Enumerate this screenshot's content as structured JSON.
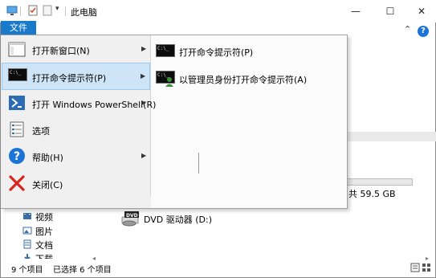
{
  "window": {
    "title": "此电脑",
    "minimize_glyph": "—",
    "maximize_glyph": "☐",
    "close_glyph": "✕",
    "help_glyph": "?",
    "ribbon_collapse_glyph": "⌃"
  },
  "file_menu": {
    "tab_label": "文件",
    "items": [
      {
        "label": "打开新窗口(N)",
        "icon": "window-icon",
        "has_submenu": true
      },
      {
        "label": "打开命令提示符(P)",
        "icon": "cmd-icon",
        "has_submenu": true,
        "highlighted": true
      },
      {
        "label": "打开 Windows PowerShell(R)",
        "icon": "powershell-icon",
        "has_submenu": true
      },
      {
        "label": "选项",
        "icon": "options-icon",
        "has_submenu": false
      },
      {
        "label": "帮助(H)",
        "icon": "help-icon",
        "has_submenu": true
      },
      {
        "label": "关闭(C)",
        "icon": "close-x-icon",
        "has_submenu": false
      }
    ],
    "submenu": [
      {
        "label": "打开命令提示符(P)",
        "icon": "cmd-icon"
      },
      {
        "label": "以管理员身份打开命令提示符(A)",
        "icon": "cmd-admin-icon"
      }
    ],
    "arrow_glyph": "▶"
  },
  "background": {
    "disk_free": "共 59.5 GB",
    "dvd_label": "DVD 驱动器 (D:)",
    "dvd_badge": "DVD",
    "sidebar": [
      {
        "label": "视频",
        "icon": "video-folder-icon"
      },
      {
        "label": "图片",
        "icon": "pictures-folder-icon"
      },
      {
        "label": "文档",
        "icon": "documents-folder-icon"
      },
      {
        "label": "下载",
        "icon": "downloads-folder-icon"
      }
    ]
  },
  "status": {
    "item_count": "9 个项目",
    "selected": "已选择 6 个项目"
  },
  "colors": {
    "accent": "#1979ca",
    "highlight": "#cde5f7",
    "close_x": "#d9261c",
    "powershell": "#2b6cb4",
    "help": "#1d74d8"
  }
}
